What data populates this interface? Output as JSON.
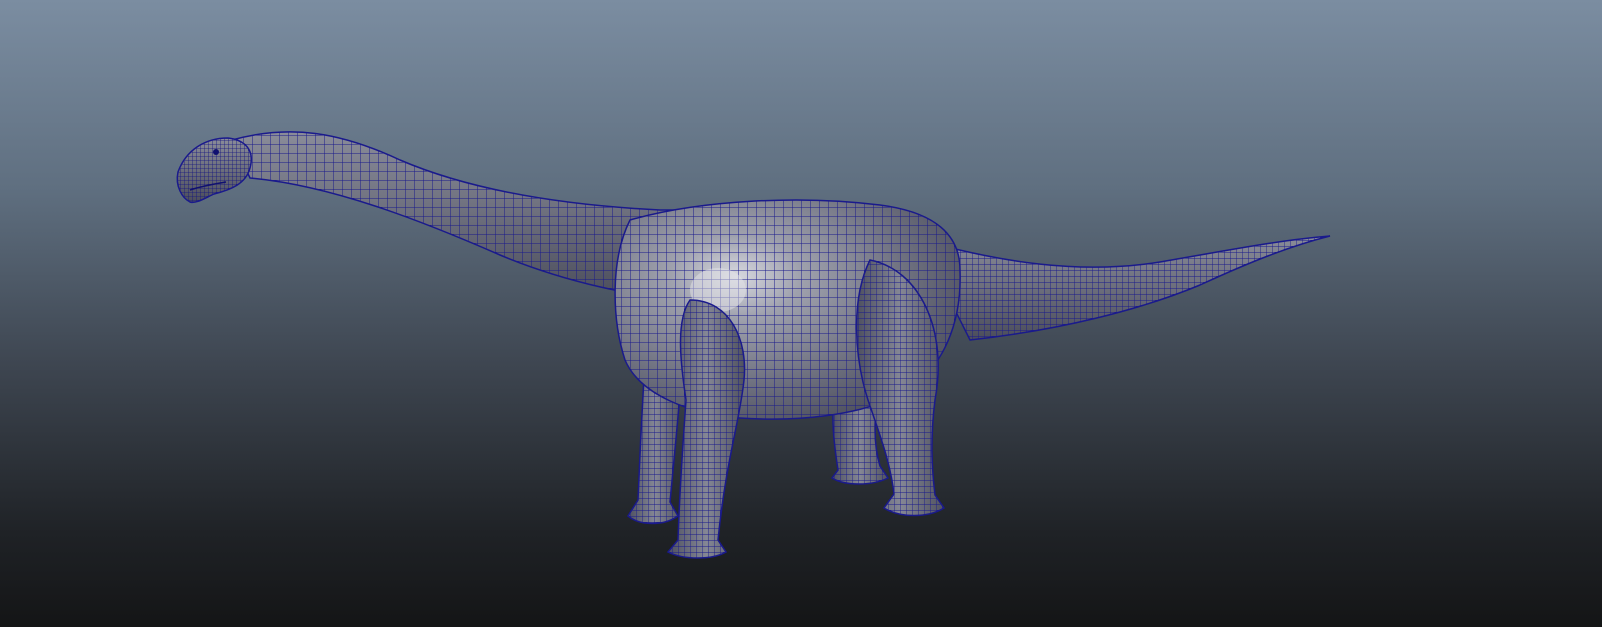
{
  "viewport": {
    "label": "",
    "model": "sauropod-wireframe-mesh"
  },
  "colors": {
    "background_top": "#7b8da1",
    "background_bottom": "#141516",
    "wireframe": "#1a1a8c",
    "mesh_fill": "#7d7f8c",
    "mesh_highlight": "#c7c8d0",
    "origin_marker": "#c0392b"
  }
}
